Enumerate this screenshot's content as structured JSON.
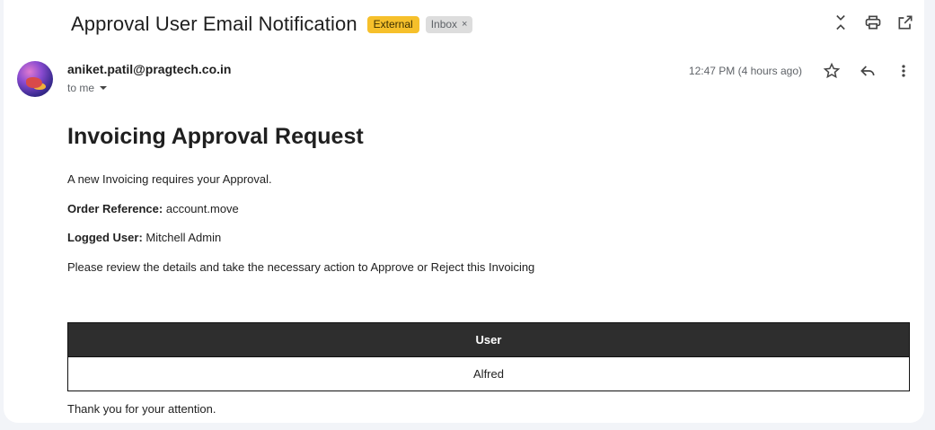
{
  "email": {
    "subject": "Approval User Email Notification",
    "labels": {
      "external": "External",
      "inbox": "Inbox",
      "remove_symbol": "×"
    },
    "sender": "aniket.patil@pragtech.co.in",
    "recipient_text": "to me",
    "time": "12:47 PM (4 hours ago)"
  },
  "icons": {
    "top": [
      "collapse-icon",
      "print-icon",
      "open-new-window-icon"
    ],
    "message": [
      "star-icon",
      "reply-icon",
      "more-vert-icon"
    ]
  },
  "body": {
    "heading": "Invoicing Approval Request",
    "intro": "A new Invoicing requires your Approval.",
    "order_ref_label": "Order Reference:",
    "order_ref_value": "account.move",
    "logged_user_label": "Logged User:",
    "logged_user_value": "Mitchell Admin",
    "review_text": "Please review the details and take the necessary action to Approve or Reject this Invoicing",
    "table": {
      "header": "User",
      "rows": [
        "Alfred"
      ]
    },
    "closing": "Thank you for your attention."
  }
}
